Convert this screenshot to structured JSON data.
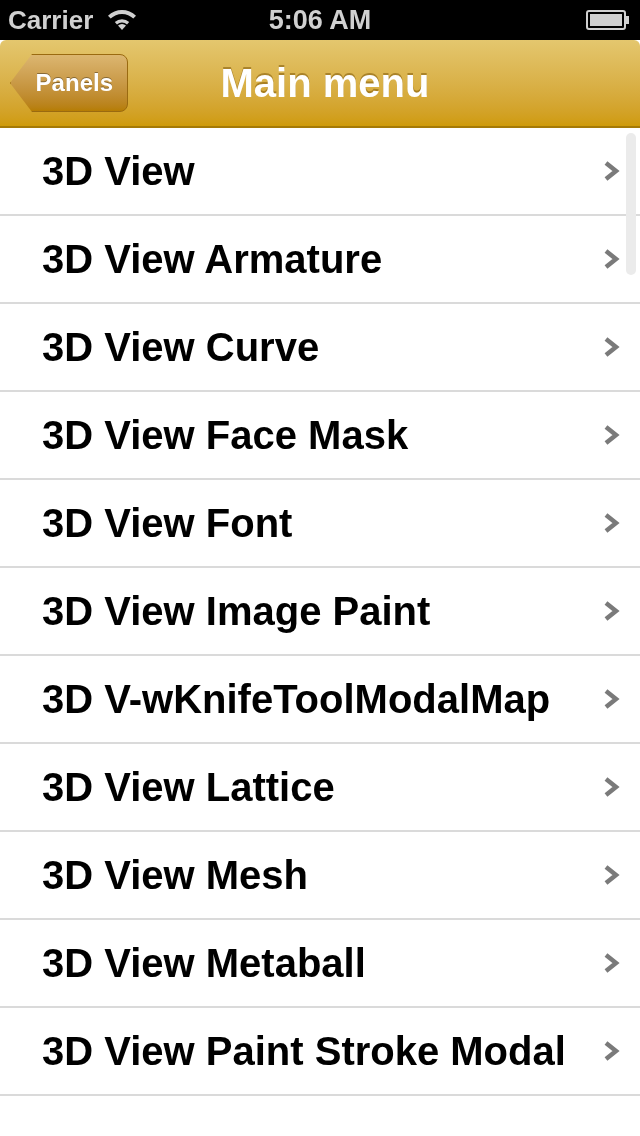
{
  "status_bar": {
    "carrier": "Carrier",
    "time": "5:06 AM"
  },
  "nav_bar": {
    "back_button": "Panels",
    "title": "Main menu"
  },
  "menu_items": [
    {
      "label": "3D View"
    },
    {
      "label": "3D View Armature"
    },
    {
      "label": "3D View Curve"
    },
    {
      "label": "3D View Face Mask"
    },
    {
      "label": "3D View Font"
    },
    {
      "label": "3D View Image Paint"
    },
    {
      "label": "3D V-wKnifeToolModalMap"
    },
    {
      "label": "3D View Lattice"
    },
    {
      "label": "3D View Mesh"
    },
    {
      "label": "3D View Metaball"
    },
    {
      "label": "3D View Paint Stroke Modal"
    }
  ]
}
